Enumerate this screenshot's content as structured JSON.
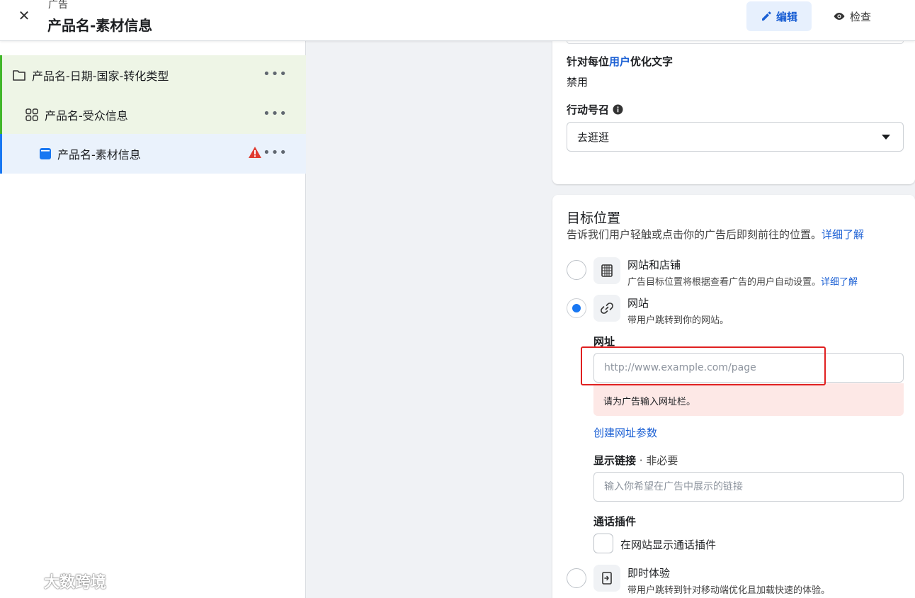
{
  "header": {
    "close_icon": "close-icon",
    "kicker": "广告",
    "title": "产品名-素材信息",
    "edit_label": "编辑",
    "edit_icon": "pencil-icon",
    "inspect_label": "检查",
    "inspect_icon": "eye-icon"
  },
  "sidebar": {
    "items": [
      {
        "label": "产品名-日期-国家-转化类型",
        "icon": "folder-icon",
        "more": "•••"
      },
      {
        "label": "产品名-受众信息",
        "icon": "grid-icon",
        "more": "•••"
      },
      {
        "label": "产品名-素材信息",
        "icon": "ad-icon",
        "more": "•••",
        "warning_icon": "warning-icon"
      }
    ]
  },
  "text_options": {
    "optimize_label_pre": "针对每位",
    "optimize_label_link": "用户",
    "optimize_label_post": "优化文字",
    "optimize_value": "禁用",
    "cta_label": "行动号召",
    "cta_info_icon": "info-icon",
    "cta_value": "去逛逛"
  },
  "destination": {
    "title": "目标位置",
    "description": "告诉我们用户轻触或点击你的广告后即刻前往的位置。",
    "learn_more": "详细了解",
    "options": [
      {
        "title": "网站和店铺",
        "subtitle": "广告目标位置将根据查看广告的用户自动设置。",
        "link": "详细了解",
        "icon": "store-icon",
        "selected": false
      },
      {
        "title": "网站",
        "subtitle": "带用户跳转到你的网站。",
        "icon": "link-icon",
        "selected": true
      },
      {
        "title": "即时体验",
        "subtitle": "带用户跳转到针对移动端优化且加载快速的体验。",
        "icon": "instant-experience-icon",
        "selected": false
      }
    ],
    "url_label": "网址",
    "url_placeholder": "http://www.example.com/page",
    "url_error": "请为广告输入网址栏。",
    "url_params_link": "创建网址参数",
    "display_link_label": "显示链接",
    "display_link_optional": " · 非必要",
    "display_link_placeholder": "输入你希望在广告中展示的链接",
    "call_plugin_label": "通话插件",
    "call_plugin_checkbox": "在网站显示通话插件",
    "call_plugin_checked": false
  },
  "watermark": {
    "text": "大数跨境",
    "logo_icon": "logo-icon"
  },
  "colors": {
    "accent": "#1877f2",
    "link": "#1a5fd4",
    "error_bg": "#fde8e6",
    "highlight": "#e02020",
    "warning": "#e03c31"
  }
}
